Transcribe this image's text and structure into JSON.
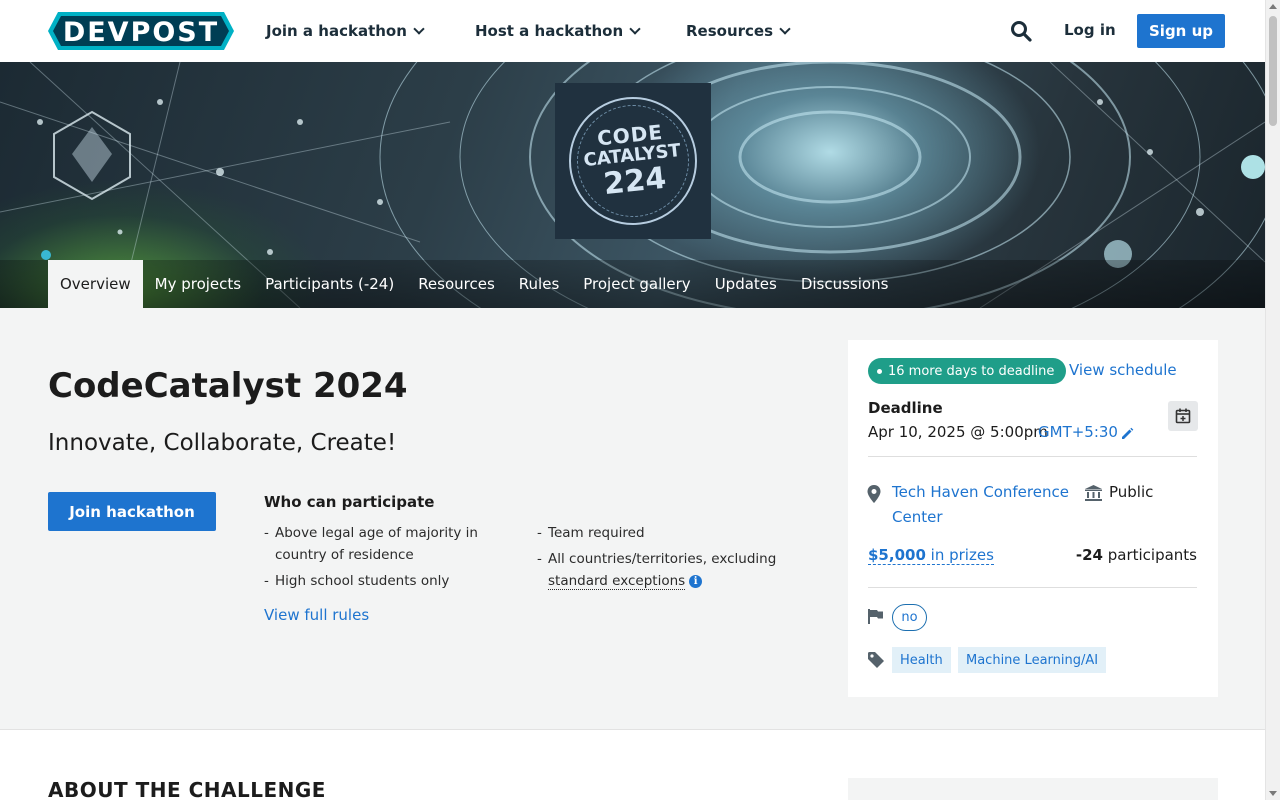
{
  "nav": {
    "logo_text": "DEVPOST",
    "menus": [
      {
        "label": "Join a hackathon"
      },
      {
        "label": "Host a hackathon"
      },
      {
        "label": "Resources"
      }
    ],
    "login": "Log in",
    "signup": "Sign up"
  },
  "banner": {
    "logo_lines": [
      "CODE",
      "CATALYST",
      "224"
    ]
  },
  "tabs": [
    {
      "label": "Overview",
      "active": true
    },
    {
      "label": "My projects"
    },
    {
      "label": "Participants (-24)"
    },
    {
      "label": "Resources"
    },
    {
      "label": "Rules"
    },
    {
      "label": "Project gallery"
    },
    {
      "label": "Updates"
    },
    {
      "label": "Discussions"
    }
  ],
  "hackathon": {
    "title": "CodeCatalyst 2024",
    "tagline": "Innovate, Collaborate, Create!",
    "join_label": "Join hackathon",
    "who_heading": "Who can participate",
    "eligibility_left": [
      "Above legal age of majority in country of residence",
      "High school students only"
    ],
    "eligibility_right": [
      "Team required",
      "All countries/territories, excluding"
    ],
    "standard_exceptions": "standard exceptions",
    "view_rules": "View full rules"
  },
  "sidebar": {
    "days_left": "16 more days to deadline",
    "view_schedule": "View schedule",
    "deadline_heading": "Deadline",
    "deadline_date": "Apr 10, 2025 @ 5:00pm",
    "timezone": "GMT+5:30",
    "location": "Tech Haven Conference Center",
    "visibility": "Public",
    "prize_amount": "$5,000",
    "prize_suffix": "in prizes",
    "participant_count": "-24",
    "participant_suffix": "participants",
    "managed_tag": "no",
    "themes": [
      "Health",
      "Machine Learning/AI"
    ]
  },
  "about": {
    "heading": "ABOUT THE CHALLENGE"
  },
  "colors": {
    "brand_blue": "#1e74cf",
    "deadline_green": "#1f9e89",
    "logo_navy": "#003e54",
    "logo_teal": "#00b1c5"
  }
}
